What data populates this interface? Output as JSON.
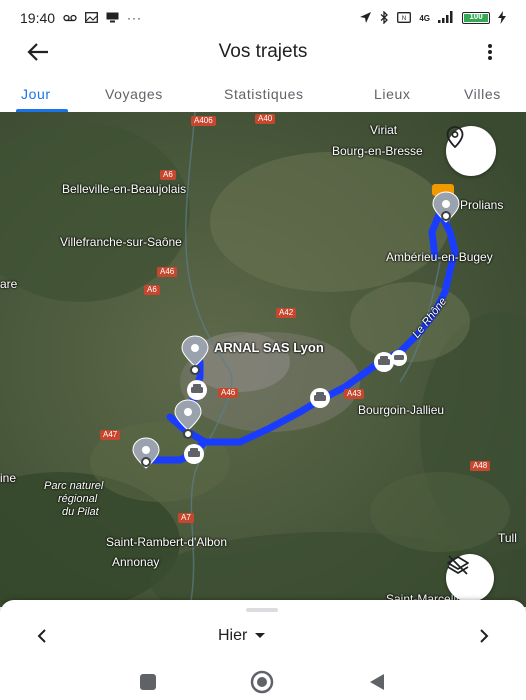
{
  "status_bar": {
    "time": "19:40",
    "left_icons": [
      "voicemail-icon",
      "gallery-icon",
      "cast-icon",
      "more-dots-icon"
    ],
    "right_icons": [
      "location-arrow-icon",
      "bluetooth-icon",
      "nfc-icon",
      "signal-icon",
      "battery-icon",
      "charging-icon"
    ],
    "network_label": "4G",
    "battery_level_pct": 100,
    "battery_label": "100"
  },
  "app_bar": {
    "title": "Vos trajets",
    "back_icon": "arrow-left-icon",
    "menu_icon": "more-vert-icon"
  },
  "tabs": [
    {
      "label": "Jour",
      "active": true
    },
    {
      "label": "Voyages",
      "active": false
    },
    {
      "label": "Statistiques",
      "active": false
    },
    {
      "label": "Lieux",
      "active": false
    },
    {
      "label": "Villes",
      "active": false
    }
  ],
  "map": {
    "route_color": "#1a3cff",
    "pin_color": "#9aa3ad",
    "labels": {
      "viriat": "Viriat",
      "bourg": "Bourg-en-Bresse",
      "belleville": "Belleville-en-Beaujolais",
      "villefranche": "Villefranche-sur-Saône",
      "proliance": "Prolians",
      "amberieu": "Ambérieu-en-Bugey",
      "are": "are",
      "arnal": "ARNAL SAS Lyon",
      "le_rhone": "Le Rhône",
      "bourgoin": "Bourgoin-Jallieu",
      "ine": "ine",
      "pilat_1": "Parc naturel",
      "pilat_2": "régional",
      "pilat_3": "du Pilat",
      "st_rambert": "Saint-Rambert-d'Albon",
      "annonay": "Annonay",
      "tull": "Tull",
      "st_marcellin": "Saint-Marcellin"
    },
    "roads": {
      "a406": "A406",
      "a40": "A40",
      "a6_top": "A6",
      "a46_n": "A46",
      "a6_mid": "A6",
      "a42": "A42",
      "a46_s": "A46",
      "a43": "A43",
      "a47": "A47",
      "a48": "A48",
      "a7": "A7"
    },
    "location_button_icon": "map-pin-icon",
    "layers_button_icon": "layers-off-icon"
  },
  "bottom_sheet": {
    "date_label": "Hier",
    "prev_icon": "chevron-left-icon",
    "next_icon": "chevron-right-icon",
    "dropdown_icon": "caret-down-icon"
  },
  "system_nav": {
    "recents_icon": "square-icon",
    "home_icon": "circle-icon",
    "back_icon": "triangle-back-icon"
  }
}
